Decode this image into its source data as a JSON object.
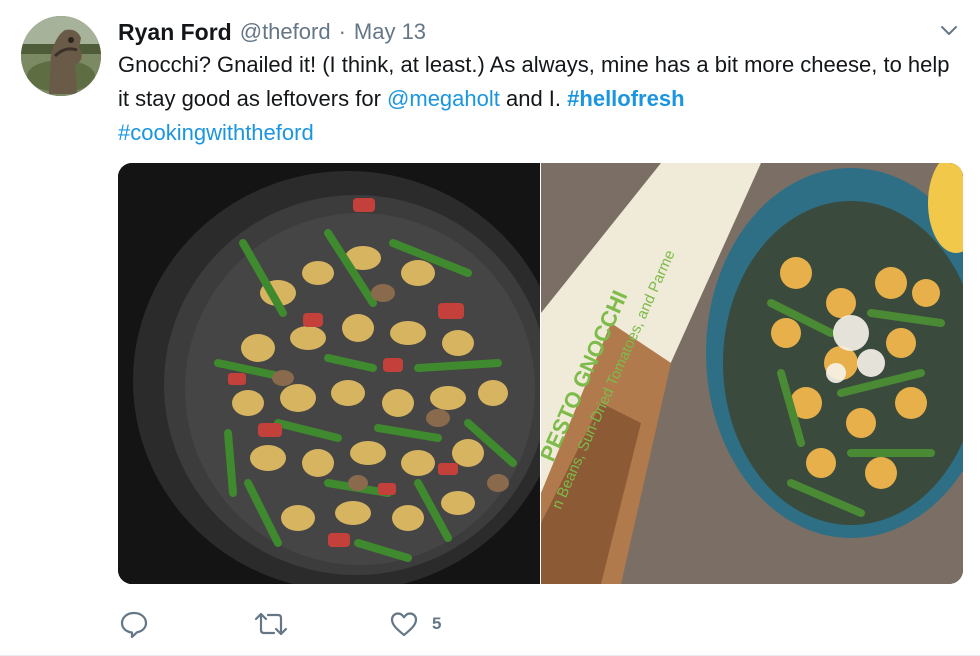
{
  "tweet": {
    "author_name": "Ryan Ford",
    "author_handle": "@theford",
    "separator": "·",
    "date": "May 13",
    "text_part1": "Gnocchi? Gnailed it! (I think, at least.) As always, mine has a bit more cheese, to help it stay good as leftovers for ",
    "mention": "@megaholt",
    "text_part2": " and I. ",
    "hashtag1": "#hellofresh",
    "hashtag2": "#cookingwiththeford",
    "box_text_main": "PESTO GNOCCHI",
    "box_text_sub": "n Beans, Sun-Dried Tomatoes, and Parme"
  },
  "actions": {
    "reply_count": "",
    "retweet_count": "",
    "like_count": "5"
  },
  "colors": {
    "link": "#1b95e0",
    "secondary_text": "#657786",
    "primary_text": "#14171a",
    "box_green": "#7dbb4a"
  },
  "icons": {
    "reply": "reply-icon",
    "retweet": "retweet-icon",
    "like": "heart-icon",
    "more": "chevron-down-icon"
  }
}
